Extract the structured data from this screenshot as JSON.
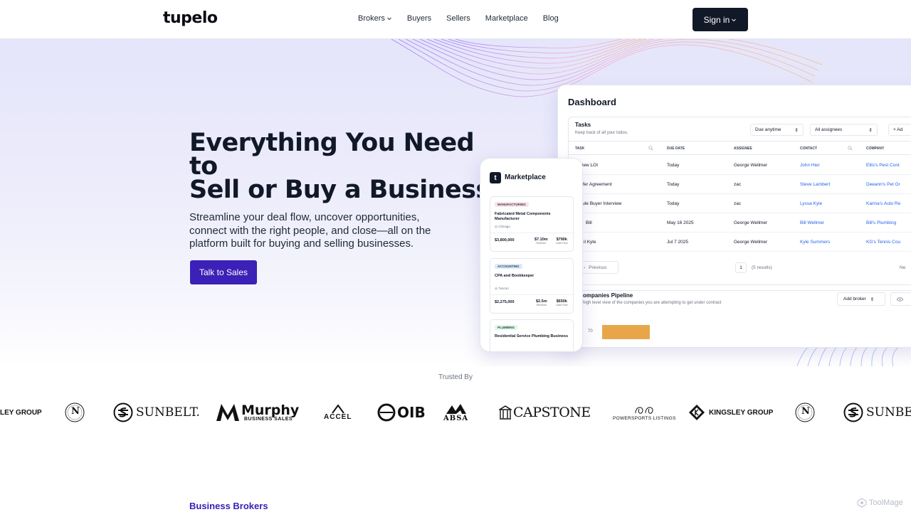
{
  "nav": {
    "logo": "tupelo",
    "items": [
      {
        "label": "Brokers",
        "dropdown": true
      },
      {
        "label": "Buyers"
      },
      {
        "label": "Sellers"
      },
      {
        "label": "Marketplace"
      },
      {
        "label": "Blog"
      }
    ],
    "signin_label": "Sign in"
  },
  "hero": {
    "title_lines": [
      "Everything You Need",
      "to",
      "Sell or Buy a Business"
    ],
    "subtitle": "Streamline your deal flow, uncover opportunities, connect with the right people, and close—all on the platform built for buying and selling businesses.",
    "cta_label": "Talk to Sales"
  },
  "dashboard": {
    "title": "Dashboard",
    "tasks": {
      "title": "Tasks",
      "subtitle": "Keep track of all your todos.",
      "filter_due": "Due anytime",
      "filter_assignee": "All assignees",
      "add_label": "+ Ad",
      "columns": [
        "TASK",
        "DUE DATE",
        "ASSIGNEE",
        "CONTACT",
        "COMPANY"
      ],
      "rows": [
        {
          "task": "iew LOI",
          "due": "Today",
          "assignee": "George Wellmer",
          "contact": "John Hier",
          "company": "Ellis's Pest Cont"
        },
        {
          "task": "nsfer Agreement",
          "due": "Today",
          "assignee": "zac",
          "contact": "Steve Lambert",
          "company": "Deeann's Pet Gr"
        },
        {
          "task": "edule Buyer Interview",
          "due": "Today",
          "assignee": "zac",
          "contact": "Lyssa Kyle",
          "company": "Karina's Auto Re"
        },
        {
          "task": "Bill",
          "due": "May 16 2025",
          "assignee": "George Wellmer",
          "contact": "Bill Wellmer",
          "company": "Bill's Plumbing"
        },
        {
          "task": "il Kyle",
          "due": "Jul 7 2025",
          "assignee": "George Wellmer",
          "contact": "Kyle Summers",
          "company": "KG's Tennis Cou"
        }
      ],
      "prev_label": "Previous",
      "page": "1",
      "results": "(5 results)",
      "next_label": "Ne"
    },
    "pipeline": {
      "title": "ompanies Pipeline",
      "subtitle": "high level view of the companies you are attempting to get under contract",
      "add_broker": "Add broker",
      "axis_value": "70"
    }
  },
  "marketplace": {
    "icon_letter": "t",
    "title": "Marketplace",
    "listings": [
      {
        "tag": "MANUFACTURING",
        "title": "Fabricated Metal Components Manufacturer",
        "location": "Chicago",
        "price": "$3,800,000",
        "revenue": "$7.10m",
        "revenue_label": "Revenue",
        "cashflow": "$790k",
        "cashflow_label": "Cash Flow"
      },
      {
        "tag": "ACCOUNTING",
        "title": "CPA and Bookkeeper",
        "location": "Tuscon",
        "price": "$2,275,000",
        "revenue": "$2.5m",
        "revenue_label": "Revenue",
        "cashflow": "$650k",
        "cashflow_label": "Cash Flow"
      },
      {
        "tag": "PLUMBING",
        "title": "Residential Service Plumbing Business"
      }
    ]
  },
  "trusted": {
    "label": "Trusted By",
    "logos": [
      "LEY GROUP",
      "N",
      "SUNBELT.",
      "Murphy",
      "BUSINESS SALES",
      "ACCEL",
      "OIB",
      "ABSA",
      "CAPSTONE",
      "POWERSPORTS LISTINGS",
      "KINGSLEY GROUP",
      "N",
      "SUNBEL"
    ]
  },
  "section_label": "Business Brokers",
  "watermark": "ToolMage",
  "colors": {
    "brand": "#3b21b7",
    "dark": "#111827",
    "link": "#2563eb",
    "bar": "#e8a64b"
  }
}
